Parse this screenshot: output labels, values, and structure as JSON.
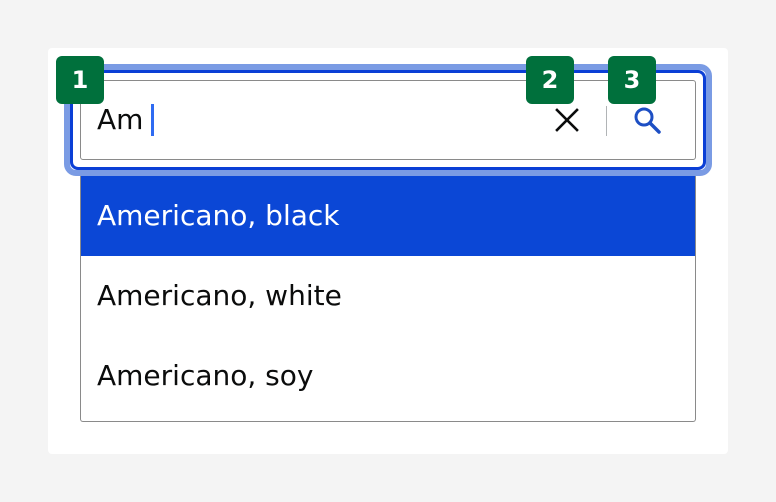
{
  "search": {
    "value": "Am",
    "clear_icon": "close-icon",
    "search_icon": "search-icon",
    "accent_color": "#0b47d6",
    "focus_color": "#7a9be4"
  },
  "options": [
    {
      "label": "Americano, black",
      "selected": true
    },
    {
      "label": "Americano, white",
      "selected": false
    },
    {
      "label": "Americano, soy",
      "selected": false
    }
  ],
  "badges": [
    "1",
    "2",
    "3"
  ],
  "badge_color": "#00703c"
}
